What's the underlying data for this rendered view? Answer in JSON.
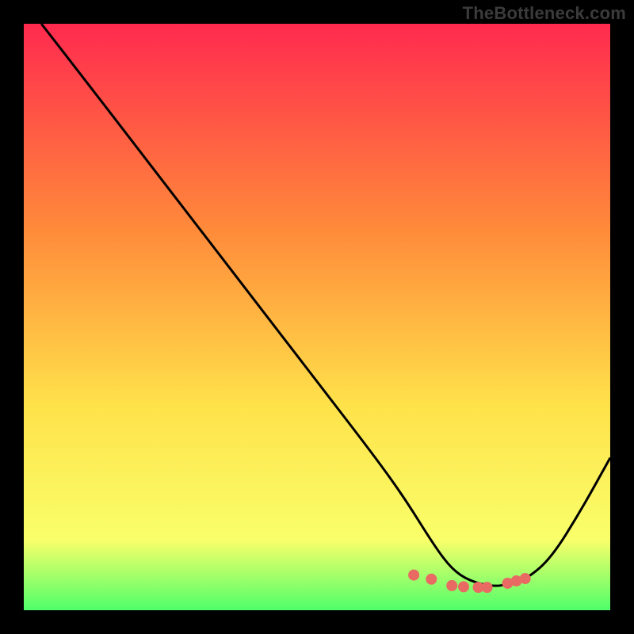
{
  "watermark": "TheBottleneck.com",
  "colors": {
    "bg": "#000000",
    "stroke": "#000000",
    "dots": "#e96a63",
    "grad_top": "#ff2a4f",
    "grad_mid1": "#ff8a3a",
    "grad_mid2": "#ffe24a",
    "grad_bottom1": "#f9ff6a",
    "grad_bottom2": "#4fff6a"
  },
  "chart_data": {
    "type": "line",
    "title": "",
    "xlabel": "",
    "ylabel": "",
    "xlim": [
      0,
      100
    ],
    "ylim": [
      0,
      100
    ],
    "series": [
      {
        "name": "curve",
        "x": [
          3,
          10,
          20,
          30,
          40,
          50,
          60,
          65,
          70,
          73,
          76,
          80,
          83,
          86,
          90,
          95,
          100
        ],
        "y": [
          100,
          91,
          78,
          65,
          52,
          39,
          26,
          19,
          11,
          7,
          5,
          4,
          4.5,
          5.5,
          9,
          17,
          26
        ]
      }
    ],
    "dots": {
      "name": "highlight",
      "x": [
        66.5,
        69.5,
        73.0,
        75.0,
        77.5,
        79.0,
        82.5,
        84.0,
        85.5
      ],
      "y": [
        6.0,
        5.3,
        4.2,
        4.0,
        3.9,
        3.9,
        4.6,
        5.0,
        5.4
      ]
    }
  }
}
